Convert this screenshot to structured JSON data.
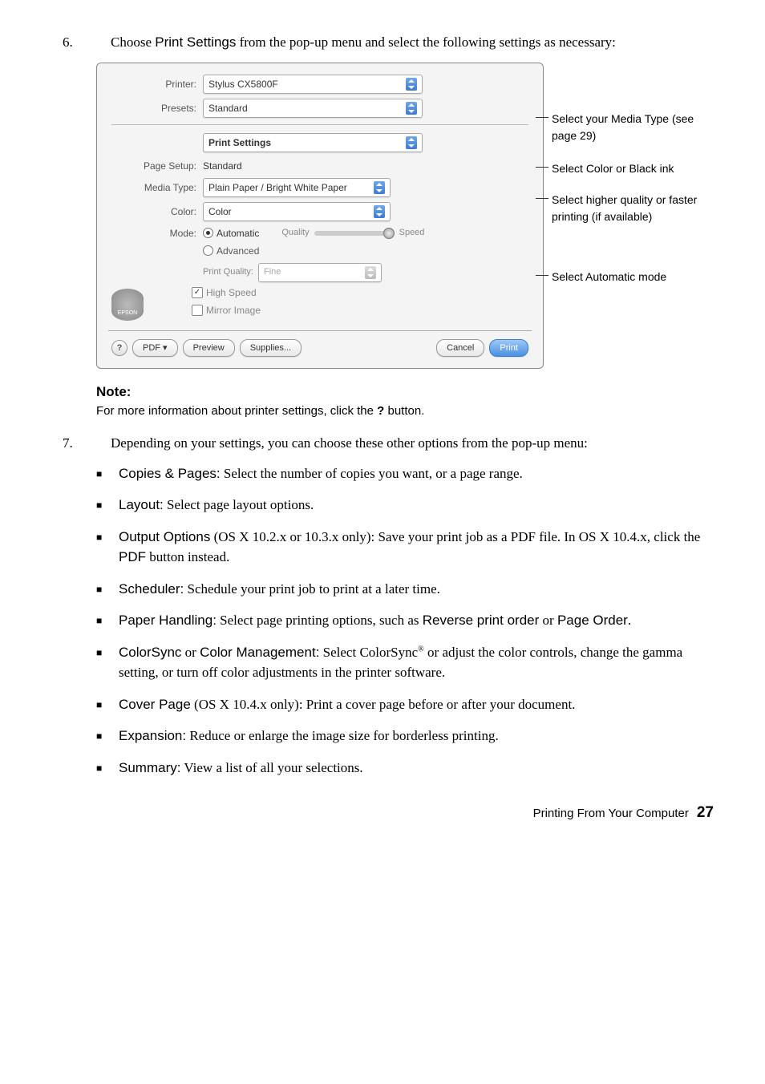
{
  "step6": {
    "num": "6.",
    "text_before": "Choose ",
    "text_bold": "Print Settings",
    "text_after": " from the pop-up menu and select the following settings as necessary:"
  },
  "dialog": {
    "printer_label": "Printer:",
    "printer_value": "Stylus CX5800F",
    "presets_label": "Presets:",
    "presets_value": "Standard",
    "section_value": "Print Settings",
    "page_setup_label": "Page Setup:",
    "page_setup_value": "Standard",
    "media_type_label": "Media Type:",
    "media_type_value": "Plain Paper / Bright White Paper",
    "color_label": "Color:",
    "color_value": "Color",
    "mode_label": "Mode:",
    "mode_auto": "Automatic",
    "mode_advanced": "Advanced",
    "quality_label": "Quality",
    "speed_label": "Speed",
    "print_quality_label": "Print Quality:",
    "print_quality_value": "Fine",
    "high_speed": "High Speed",
    "mirror_image": "Mirror Image",
    "epson": "EPSON",
    "help": "?",
    "pdf": "PDF ▾",
    "preview": "Preview",
    "supplies": "Supplies...",
    "cancel": "Cancel",
    "print": "Print"
  },
  "callouts": {
    "c1a": "Select your ",
    "c1b": "Media Type",
    "c1c": " (see page 29)",
    "c2a": "Select ",
    "c2b": "Color",
    "c2c": " or ",
    "c2d": "Black",
    "c2e": " ink",
    "c3a": "Select higher quality or faster printing (if available)",
    "c4a": "Select ",
    "c4b": "Automatic",
    "c4c": " mode"
  },
  "note": {
    "title": "Note:",
    "text_before": "For more information about printer settings, click the ",
    "text_bold": "?",
    "text_after": " button."
  },
  "step7": {
    "num": "7.",
    "text": "Depending on your settings, you can choose these other options from the pop-up menu:"
  },
  "bullets": {
    "b1_bold": "Copies & Pages:",
    "b1_rest": " Select the number of copies you want, or a page range.",
    "b2_bold": "Layout:",
    "b2_rest": " Select page layout options.",
    "b3_bold": "Output Options",
    "b3_mid": " (OS X 10.2.x or 10.3.x only): Save your print job as a PDF file. In OS X 10.4.x, click the ",
    "b3_bold2": "PDF",
    "b3_rest": " button instead.",
    "b4_bold": "Scheduler:",
    "b4_rest": " Schedule your print job to print at a later time.",
    "b5_bold": "Paper Handling:",
    "b5_mid": " Select page printing options, such as ",
    "b5_bold2": "Reverse print order",
    "b5_or": " or ",
    "b5_bold3": "Page Order",
    "b5_rest": ".",
    "b6_bold1": "ColorSync",
    "b6_or": " or ",
    "b6_bold2": "Color Management:",
    "b6_mid": " Select ColorSync",
    "b6_reg": "®",
    "b6_rest": " or adjust the color controls, change the gamma setting, or turn off color adjustments in the printer software.",
    "b7_bold": "Cover Page",
    "b7_rest": " (OS X 10.4.x only): Print a cover page before or after your document.",
    "b8_bold": "Expansion:",
    "b8_rest": " Reduce or enlarge the image size for borderless printing.",
    "b9_bold": "Summary:",
    "b9_rest": " View a list of all your selections."
  },
  "footer": {
    "text": "Printing From Your Computer",
    "page": "27"
  }
}
